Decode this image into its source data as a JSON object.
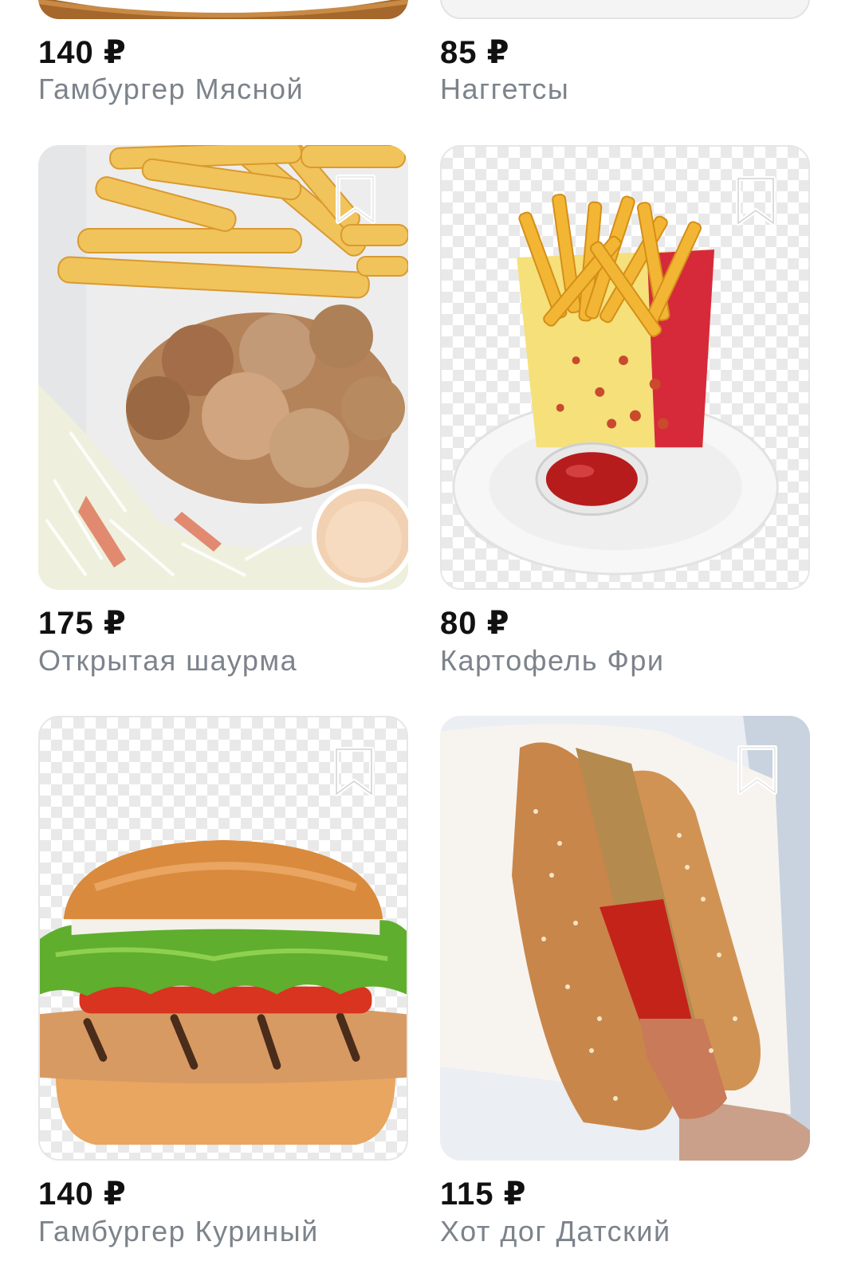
{
  "products": [
    {
      "price": "140 ₽",
      "title": "Гамбургер Мясной",
      "image": "burger-image"
    },
    {
      "price": "85 ₽",
      "title": "Наггетсы",
      "image": "nuggets-image"
    },
    {
      "price": "175 ₽",
      "title": "Открытая шаурма",
      "image": "open-shawarma-image",
      "bookmark_icon": "bookmark-outline-icon"
    },
    {
      "price": "80 ₽",
      "title": "Картофель Фри",
      "image": "french-fries-image",
      "bookmark_icon": "bookmark-outline-icon"
    },
    {
      "price": "140 ₽",
      "title": "Гамбургер Куриный",
      "image": "chicken-burger-image",
      "bookmark_icon": "bookmark-outline-icon"
    },
    {
      "price": "115 ₽",
      "title": "Хот дог Датский",
      "image": "danish-hot-dog-image",
      "bookmark_icon": "bookmark-outline-icon"
    }
  ],
  "colors": {
    "price_text": "#111111",
    "title_text": "#7c838b",
    "bookmark_stroke": "#ffffff",
    "background": "#ffffff"
  }
}
